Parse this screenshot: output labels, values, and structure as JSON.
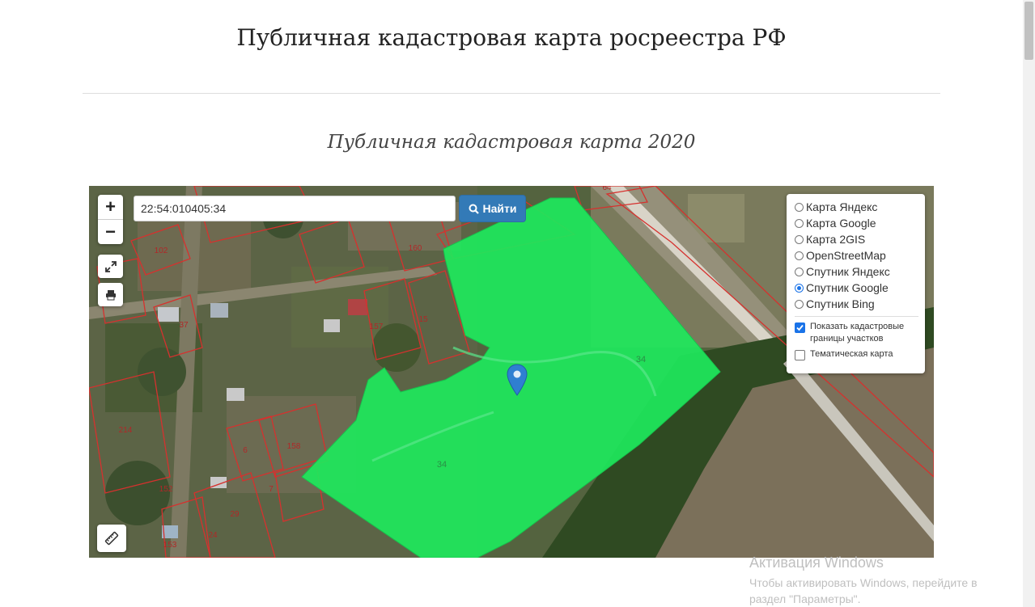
{
  "header": {
    "title": "Публичная кадастровая карта росреестра РФ"
  },
  "main": {
    "subtitle": "Публичная кадастровая карта 2020"
  },
  "map": {
    "search": {
      "value": "22:54:010405:34",
      "button_label": "Найти"
    },
    "zoom": {
      "in": "+",
      "out": "−"
    },
    "layers": {
      "options": [
        {
          "label": "Карта Яндекс",
          "selected": false
        },
        {
          "label": "Карта Google",
          "selected": false
        },
        {
          "label": "Карта 2GIS",
          "selected": false
        },
        {
          "label": "OpenStreetMap",
          "selected": false
        },
        {
          "label": "Спутник Яндекс",
          "selected": false
        },
        {
          "label": "Спутник Google",
          "selected": true
        },
        {
          "label": "Спутник Bing",
          "selected": false
        }
      ],
      "show_boundaries": {
        "label": "Показать кадастровые границы участков",
        "checked": true
      },
      "thematic": {
        "label": "Тематическая карта",
        "checked": false
      }
    },
    "parcel_labels": [
      "102",
      "160",
      "37",
      "157",
      "15",
      "34",
      "34",
      "214",
      "6",
      "158",
      "152",
      "7",
      "29",
      "24",
      "153",
      "64"
    ],
    "highlight_color": "#1ee85c"
  },
  "watermark": {
    "title": "Активация Windows",
    "subtitle": "Чтобы активировать Windows, перейдите в раздел \"Параметры\"."
  }
}
